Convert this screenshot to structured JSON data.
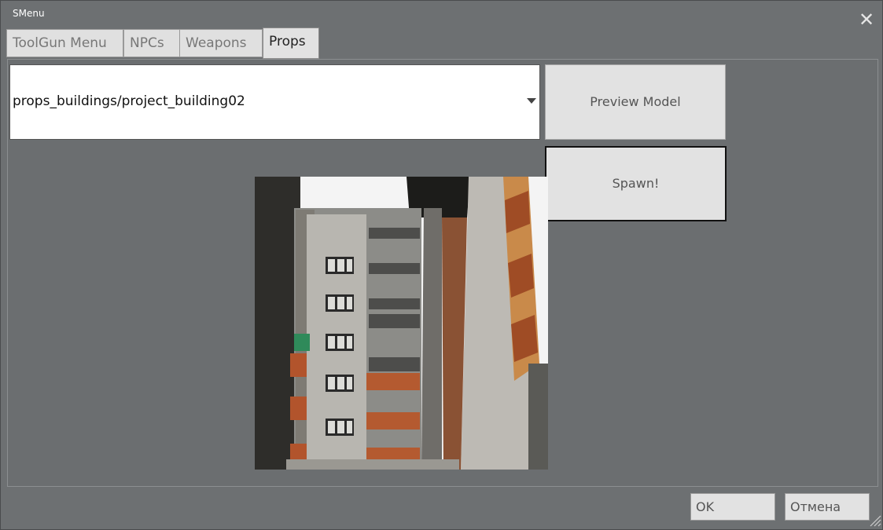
{
  "window": {
    "title": "SMenu",
    "close_icon": "close-icon"
  },
  "tabs": [
    {
      "label": "ToolGun Menu",
      "active": false
    },
    {
      "label": "NPCs",
      "active": false
    },
    {
      "label": "Weapons",
      "active": false
    },
    {
      "label": "Props",
      "active": true
    }
  ],
  "props": {
    "selected_model": "props_buildings/project_building02",
    "preview_label": "Preview Model",
    "spawn_label": "Spawn!",
    "preview_image": "model-preview-building"
  },
  "footer": {
    "ok_label": "OK",
    "cancel_label": "Отмена"
  },
  "colors": {
    "window_bg": "#6d7072",
    "button_bg": "#e2e2e2",
    "tab_active_text": "#222222",
    "tab_inactive_text": "#777777"
  }
}
